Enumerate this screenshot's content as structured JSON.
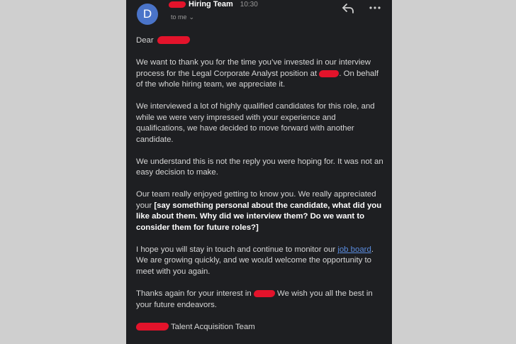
{
  "header": {
    "avatar_letter": "D",
    "sender": "Hiring Team",
    "time": "10:30",
    "to": "to me",
    "icons": [
      "reply-icon",
      "more-icon",
      "chevron-down-icon"
    ]
  },
  "email": {
    "greeting": "Dear",
    "p1_a": "We want to thank you for the time you’ve invested in our interview process for the Legal Corporate Analyst position at",
    "p1_b": ". On behalf of the whole hiring team, we appreciate it.",
    "p2": "We interviewed a lot of highly qualified candidates for this role, and while we were very impressed with your experience and qualifications, we have decided to move forward with another candidate.",
    "p3": "We understand this is not the reply you were hoping for. It was not an easy decision to make.",
    "p4_a": "Our team really enjoyed getting to know you. We really appreciated your",
    "p4_bold": "[say something personal about the candidate, what did you like about them. Why did we interview them? Do we want to consider them for future roles?]",
    "p5_a": "I hope you will stay in touch and continue to monitor our",
    "p5_link": "job board",
    "p5_b": ". We are growing quickly, and we would welcome the opportunity to meet with you again.",
    "p6_a": "Thanks again for your interest in",
    "p6_b": " We wish you all the best in your future endeavors.",
    "signature": "Talent Acquisition Team"
  },
  "colors": {
    "background": "#1e1f22",
    "avatar": "#4a74c9",
    "redaction": "#e3132b",
    "link": "#5b8de0"
  }
}
